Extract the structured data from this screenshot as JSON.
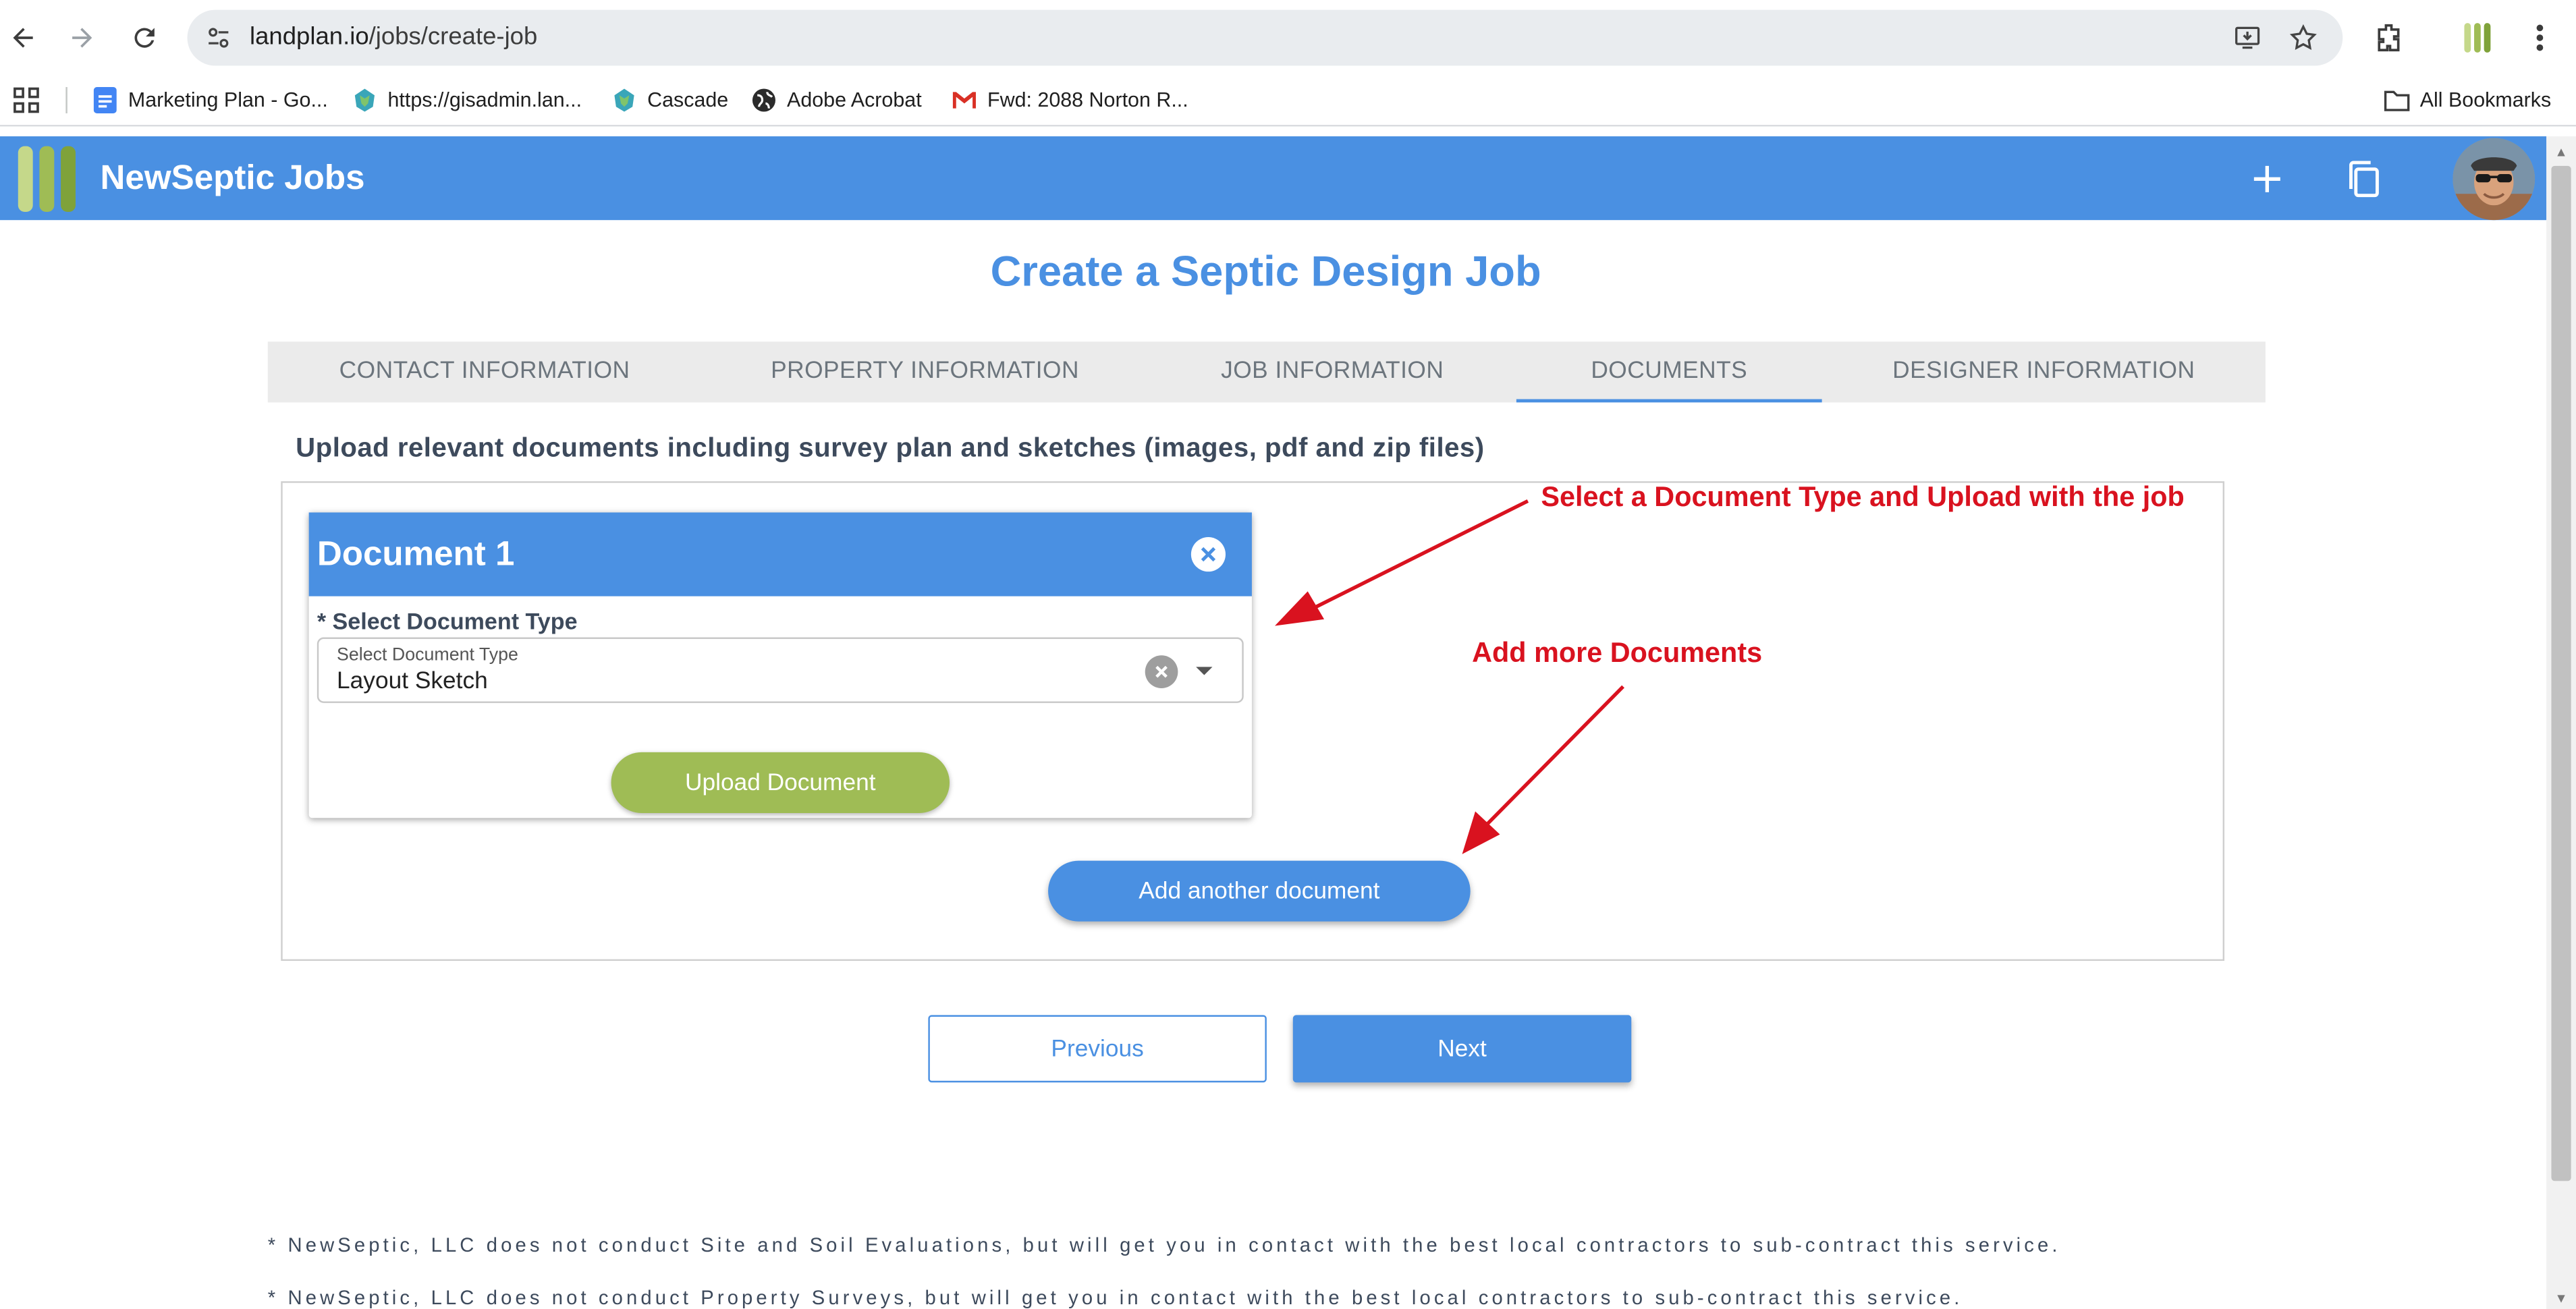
{
  "browser": {
    "url_host": "landplan.io",
    "url_path": "/jobs/create-job",
    "bookmarks": [
      {
        "label": "Marketing Plan - Go...",
        "icon": "google-docs-icon"
      },
      {
        "label": "https://gisadmin.lan...",
        "icon": "globe-map-icon"
      },
      {
        "label": "Cascade",
        "icon": "globe-map-icon"
      },
      {
        "label": "Adobe Acrobat",
        "icon": "world-icon"
      },
      {
        "label": "Fwd: 2088 Norton R...",
        "icon": "gmail-icon"
      }
    ],
    "all_bookmarks": "All Bookmarks"
  },
  "app": {
    "title": "NewSeptic Jobs",
    "logo_colors": [
      "#c5d88a",
      "#9fbc55",
      "#7fa23a"
    ]
  },
  "page": {
    "title": "Create a Septic Design Job",
    "tabs": [
      {
        "label": "CONTACT INFORMATION",
        "active": false
      },
      {
        "label": "PROPERTY INFORMATION",
        "active": false
      },
      {
        "label": "JOB INFORMATION",
        "active": false
      },
      {
        "label": "DOCUMENTS",
        "active": true
      },
      {
        "label": "DESIGNER INFORMATION",
        "active": false
      }
    ],
    "upload_hint": "Upload relevant documents including survey plan and sketches (images, pdf and zip files)",
    "document": {
      "title": "Document 1",
      "required_label": "* Select Document Type",
      "select_label": "Select Document Type",
      "select_value": "Layout Sketch",
      "upload_button": "Upload Document"
    },
    "add_button": "Add another document",
    "previous_button": "Previous",
    "next_button": "Next",
    "footnotes": [
      "* NewSeptic, LLC does not conduct Site and Soil Evaluations, but will get you in contact with the best local contractors to sub-contract this service.",
      "* NewSeptic, LLC does not conduct Property Surveys, but will get you in contact with the best local contractors to sub-contract this service."
    ]
  },
  "annotations": {
    "upload_note": "Select a Document Type and Upload with the job",
    "add_note": "Add more Documents"
  },
  "colors": {
    "primary": "#4a90e2",
    "upload_green": "#9fbc55",
    "annotation_red": "#d9121f"
  }
}
